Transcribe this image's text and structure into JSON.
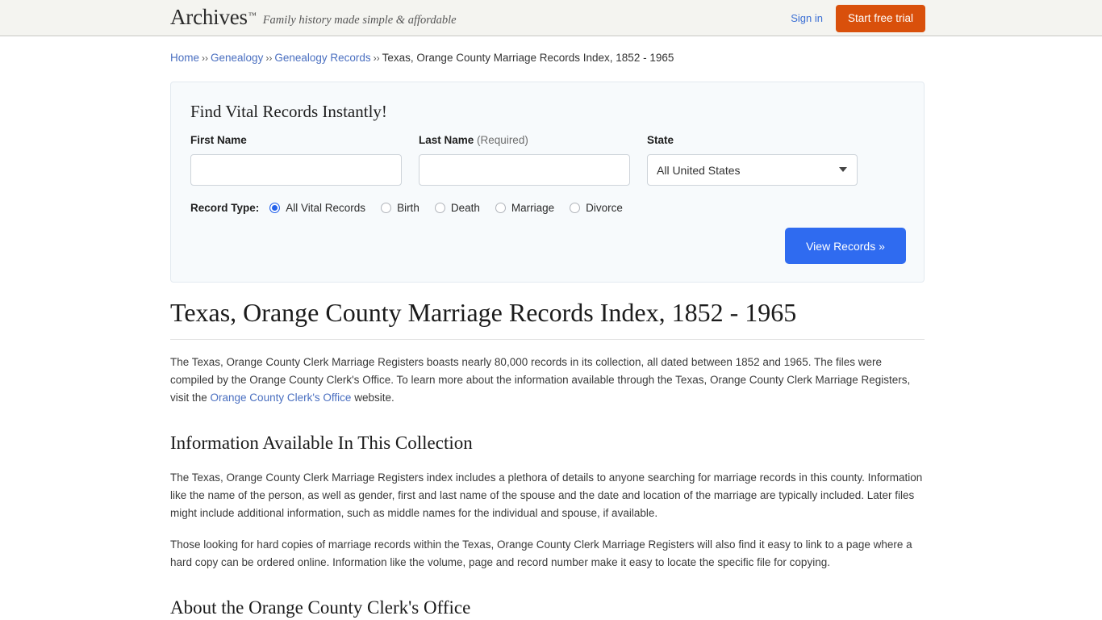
{
  "header": {
    "logo": "Archives",
    "logo_tm": "™",
    "tagline": "Family history made simple & affordable",
    "signin": "Sign in",
    "trial_button": "Start free trial",
    "bg_color": "#f4f4f0",
    "trial_color": "#d9500b"
  },
  "breadcrumb": {
    "items": [
      {
        "label": "Home",
        "link": true
      },
      {
        "label": "Genealogy",
        "link": true
      },
      {
        "label": "Genealogy Records",
        "link": true
      },
      {
        "label": "Texas, Orange County Marriage Records Index, 1852 - 1965",
        "link": false
      }
    ],
    "separator": "››"
  },
  "search_panel": {
    "title": "Find Vital Records Instantly!",
    "first_name": {
      "label": "First Name",
      "value": "",
      "placeholder": ""
    },
    "last_name": {
      "label": "Last Name",
      "required_note": "(Required)",
      "value": "",
      "placeholder": ""
    },
    "state": {
      "label": "State",
      "selected": "All United States"
    },
    "record_type": {
      "label": "Record Type:",
      "options": [
        {
          "label": "All Vital Records",
          "checked": true
        },
        {
          "label": "Birth",
          "checked": false
        },
        {
          "label": "Death",
          "checked": false
        },
        {
          "label": "Marriage",
          "checked": false
        },
        {
          "label": "Divorce",
          "checked": false
        }
      ]
    },
    "submit_button": "View Records »",
    "accent_color": "#2f6bf0"
  },
  "article": {
    "title": "Texas, Orange County Marriage Records Index, 1852 - 1965",
    "paragraph_1_part_1": "The Texas, Orange County Clerk Marriage Registers boasts nearly 80,000 records in its collection, all dated between 1852 and 1965. The files were compiled by the Orange County Clerk's Office. To learn more about the information available through the Texas, Orange County Clerk Marriage Registers, visit the ",
    "paragraph_1_link": "Orange County Clerk's Office",
    "paragraph_1_part_2": " website.",
    "section_1_title": "Information Available In This Collection",
    "paragraph_2": "The Texas, Orange County Clerk Marriage Registers index includes a plethora of details to anyone searching for marriage records in this county. Information like the name of the person, as well as gender, first and last name of the spouse and the date and location of the marriage are typically included. Later files might include additional information, such as middle names for the individual and spouse, if available.",
    "paragraph_3": "Those looking for hard copies of marriage records within the Texas, Orange County Clerk Marriage Registers will also find it easy to link to a page where a hard copy can be ordered online. Information like the volume, page and record number make it easy to locate the specific file for copying.",
    "section_2_title": "About the Orange County Clerk's Office"
  }
}
